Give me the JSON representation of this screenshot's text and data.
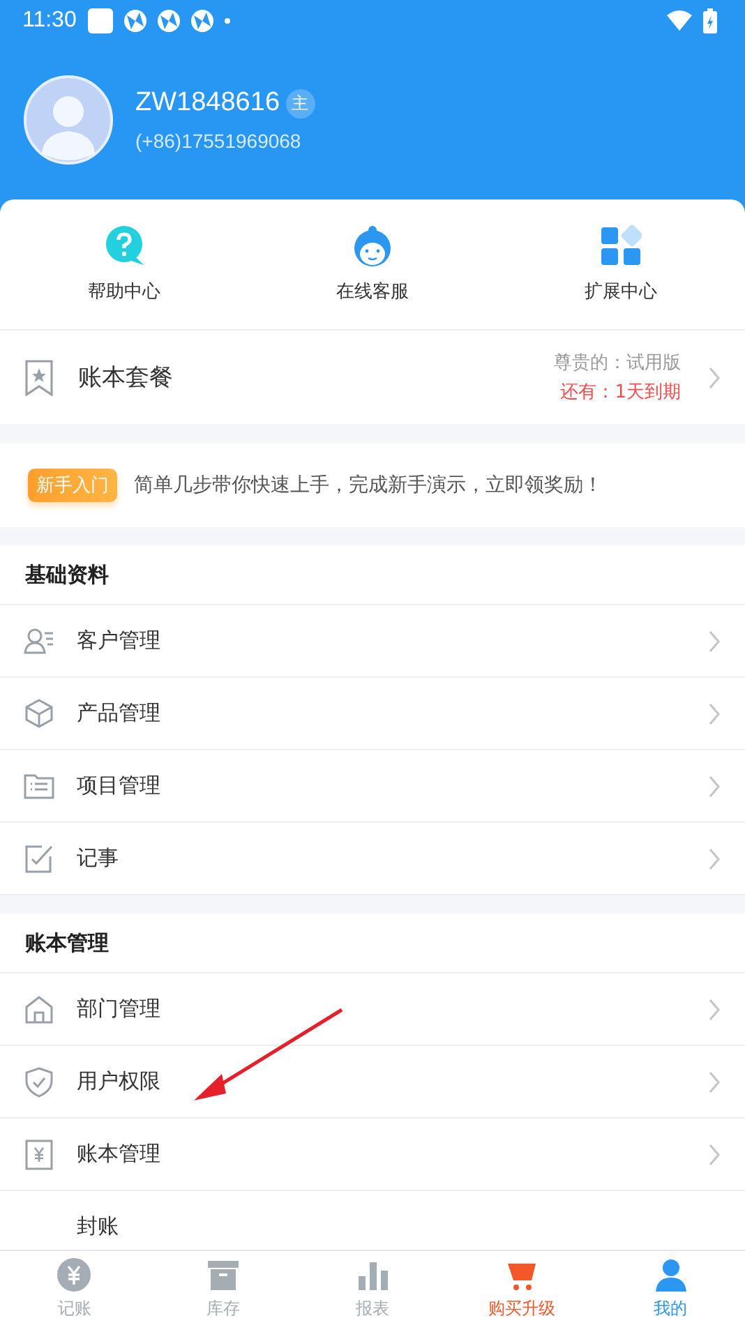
{
  "status_bar": {
    "time": "11:30"
  },
  "profile": {
    "username": "ZW1848616",
    "role_badge": "主",
    "phone": "(+86)17551969068"
  },
  "quick_actions": [
    {
      "label": "帮助中心"
    },
    {
      "label": "在线客服"
    },
    {
      "label": "扩展中心"
    }
  ],
  "plan": {
    "label": "账本套餐",
    "edition": "尊贵的：试用版",
    "expiry": "还有：1天到期"
  },
  "onboarding": {
    "badge": "新手入门",
    "text": "简单几步带你快速上手，完成新手演示，立即领奖励！"
  },
  "sections": [
    {
      "title": "基础资料",
      "items": [
        {
          "label": "客户管理"
        },
        {
          "label": "产品管理"
        },
        {
          "label": "项目管理"
        },
        {
          "label": "记事"
        }
      ]
    },
    {
      "title": "账本管理",
      "items": [
        {
          "label": "部门管理"
        },
        {
          "label": "用户权限"
        },
        {
          "label": "账本管理"
        },
        {
          "label": "封账"
        }
      ]
    }
  ],
  "tab_bar": [
    {
      "label": "记账",
      "selected": false
    },
    {
      "label": "库存",
      "selected": false
    },
    {
      "label": "报表",
      "selected": false
    },
    {
      "label": "购买升级",
      "selected": false,
      "kind": "promo"
    },
    {
      "label": "我的",
      "selected": true
    }
  ]
}
